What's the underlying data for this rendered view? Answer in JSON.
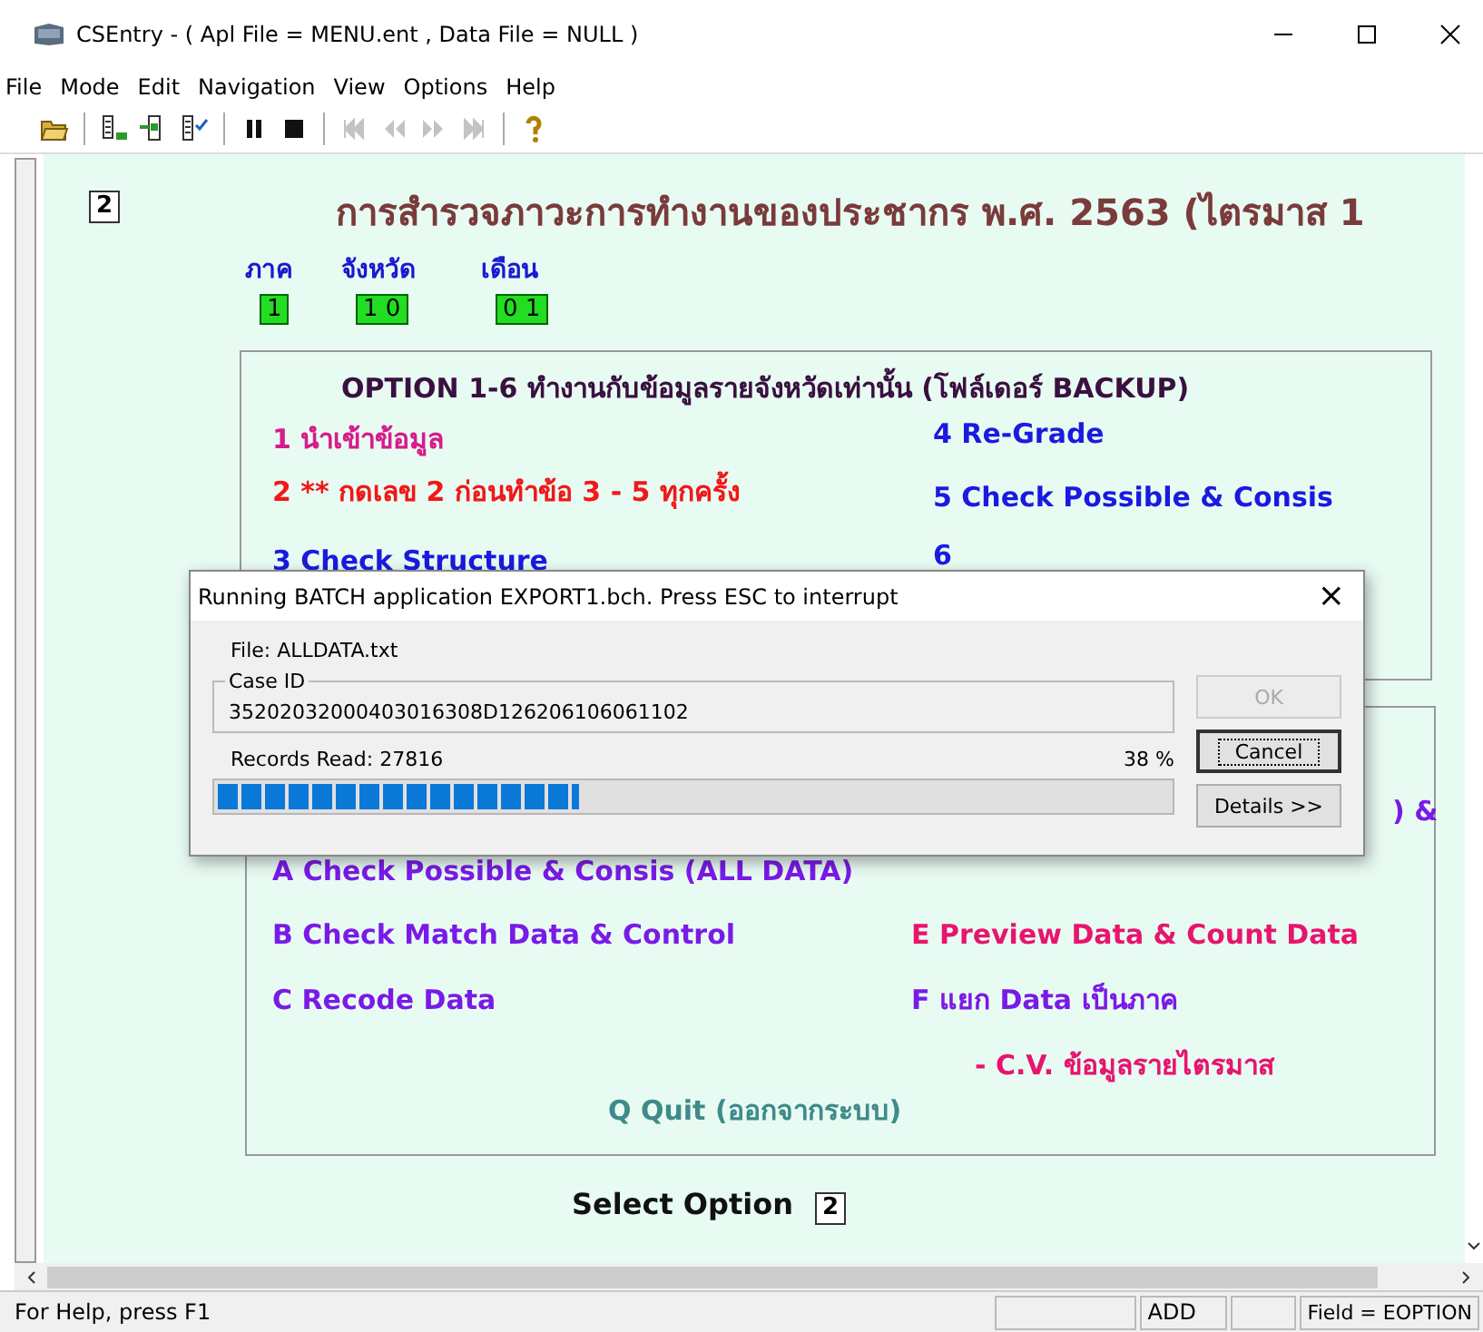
{
  "window": {
    "title": "CSEntry - ( Apl File = MENU.ent , Data File = NULL )"
  },
  "menu": [
    "File",
    "Mode",
    "Edit",
    "Navigation",
    "View",
    "Options",
    "Help"
  ],
  "toolbar": [
    {
      "kind": "open",
      "disabled": false
    },
    {
      "kind": "node-add",
      "disabled": false
    },
    {
      "kind": "node-insert",
      "disabled": false
    },
    {
      "kind": "node-check",
      "disabled": false
    },
    {
      "kind": "pause",
      "disabled": false
    },
    {
      "kind": "stop",
      "disabled": false
    },
    {
      "kind": "first",
      "disabled": true
    },
    {
      "kind": "prev",
      "disabled": true
    },
    {
      "kind": "next",
      "disabled": true
    },
    {
      "kind": "last",
      "disabled": true
    },
    {
      "kind": "help",
      "disabled": false
    }
  ],
  "form": {
    "top_field": "2",
    "title": "การสำรวจภาวะการทำงานของประชากร พ.ศ. 2563 (ไตรมาส 1",
    "id_fields": [
      {
        "label": "ภาค",
        "value": "1"
      },
      {
        "label": "จังหวัด",
        "value": "1 0"
      },
      {
        "label": "เดือน",
        "value": "0 1"
      }
    ],
    "group_1": {
      "heading": "OPTION 1-6 ทำงานกับข้อมูลรายจังหวัดเท่านั้น (โฟล์เดอร์ BACKUP)",
      "items": [
        {
          "text": "1  นำเข้าข้อมูล",
          "color": "#d81b8c"
        },
        {
          "text": "2  ** กดเลข 2 ก่อนทำข้อ 3 - 5 ทุกครั้ง",
          "color": "#f01818"
        },
        {
          "text": "3  Check Structure",
          "color": "#1a1ae0"
        },
        {
          "text": "4  Re-Grade",
          "color": "#1a1ae0"
        },
        {
          "text": "5  Check Possible & Consis",
          "color": "#1a1ae0"
        },
        {
          "text": "6",
          "color": "#1a1ae0"
        }
      ]
    },
    "group_2": {
      "items": [
        {
          "text": ") &",
          "color": "#7a1ae8"
        },
        {
          "text": "A  Check Possible & Consis (ALL DATA)",
          "color": "#7a1ae8"
        },
        {
          "text": "B  Check Match Data & Control",
          "color": "#7a1ae8"
        },
        {
          "text": "C  Recode Data",
          "color": "#7a1ae8"
        },
        {
          "text": "E  Preview Data & Count Data",
          "color": "#e8146e"
        },
        {
          "text": "F  แยก Data เป็นภาค",
          "color": "#7a1ae8"
        },
        {
          "text": "- C.V. ข้อมูลรายไตรมาส",
          "color": "#e8146e"
        },
        {
          "text": "Q   Quit (ออกจากระบบ)",
          "color": "#3f8a8a"
        }
      ]
    },
    "select_label": "Select Option",
    "select_value": "2"
  },
  "dialog": {
    "title": "Running BATCH application EXPORT1.bch. Press ESC to interrupt",
    "close": "×",
    "file": "File:  ALLDATA.txt",
    "case_id_label": "Case ID",
    "case_id": "35202032000403016308D126206106061102",
    "records": "Records Read:  27816",
    "percent": "38 %",
    "level": 0.38,
    "buttons": [
      {
        "label": "OK",
        "disabled": true,
        "focused": false
      },
      {
        "label": "Cancel",
        "disabled": false,
        "focused": true
      },
      {
        "label": "Details >>",
        "disabled": false,
        "focused": false
      }
    ]
  },
  "status_bar": {
    "help": "For Help, press F1",
    "mode": "ADD",
    "field": "Field = EOPTION"
  }
}
